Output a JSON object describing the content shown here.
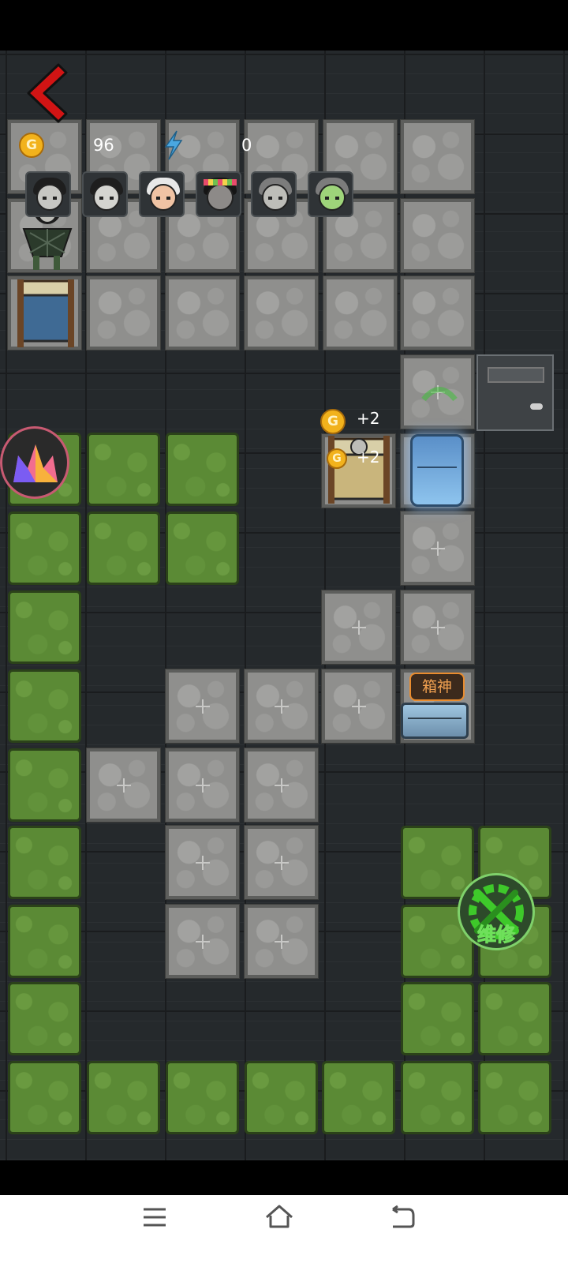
{
  "hud": {
    "coin_symbol": "G",
    "coins": "96",
    "energy": "0"
  },
  "income": [
    {
      "label": "+2"
    },
    {
      "label": "+2"
    }
  ],
  "buttons": {
    "box_god": "箱神",
    "repair": "维修"
  },
  "colors": {
    "back_arrow": "#d21414",
    "coin": "#f2b21c",
    "energy": "#4aa7e0",
    "repair_gear": "#3ec92a",
    "box_tag_border": "#e98c2e"
  },
  "avatars": [
    {
      "name": "girl-dark-hair"
    },
    {
      "name": "girl-pale"
    },
    {
      "name": "grandma-white-hair"
    },
    {
      "name": "girl-flower-crown"
    },
    {
      "name": "old-lady-grey"
    },
    {
      "name": "old-lady-green-glow"
    }
  ],
  "nav": {
    "menu_icon": "menu-icon",
    "home_icon": "home-icon",
    "back_icon": "back-icon"
  }
}
